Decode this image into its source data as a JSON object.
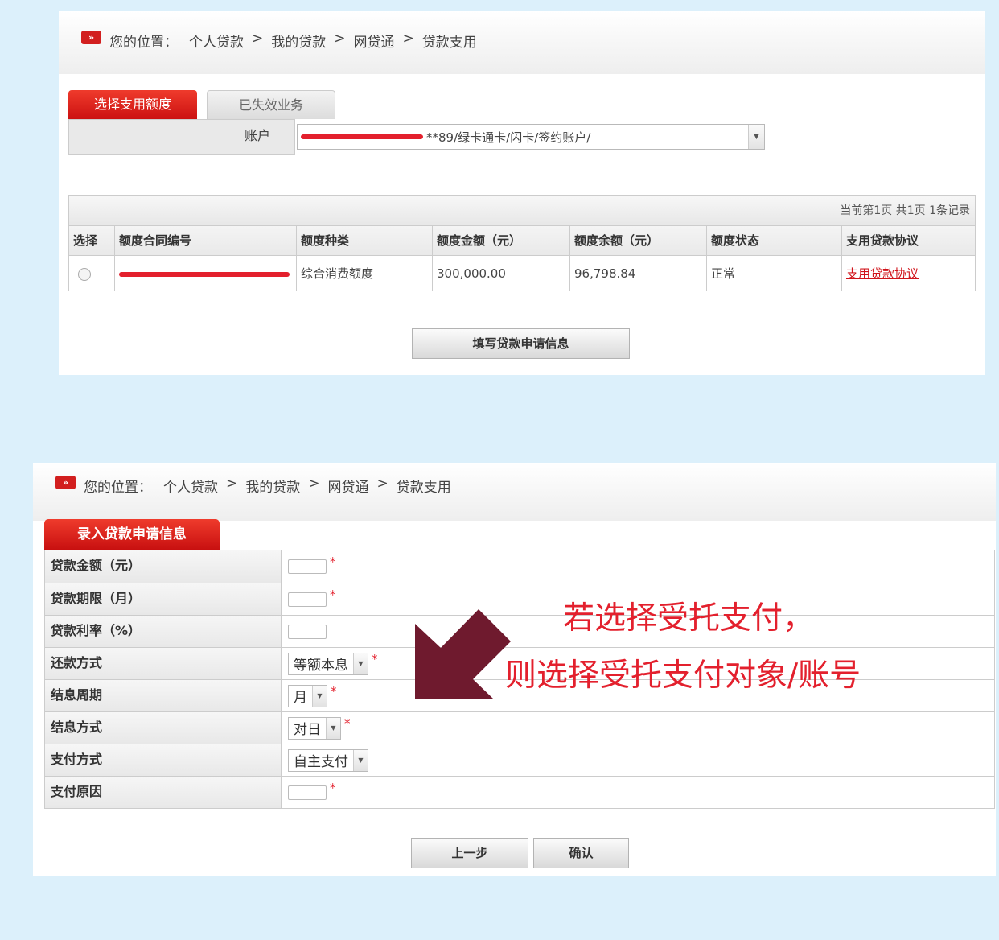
{
  "breadcrumb": {
    "icon": "double-chevron-icon",
    "prefix": "您的位置：",
    "items": [
      "个人贷款",
      "我的贷款",
      "网贷通",
      "贷款支用"
    ],
    "separator": ">"
  },
  "panel1": {
    "tabs": [
      {
        "label": "选择支用额度",
        "active": true
      },
      {
        "label": "已失效业务",
        "active": false
      }
    ],
    "account": {
      "label": "账户",
      "value_suffix": "**89/绿卡通卡/闪卡/签约账户/"
    },
    "pagination": "当前第1页 共1页 1条记录",
    "table": {
      "headers": [
        "选择",
        "额度合同编号",
        "额度种类",
        "额度金额（元）",
        "额度余额（元）",
        "额度状态",
        "支用贷款协议"
      ],
      "rows": [
        {
          "type": "综合消费额度",
          "amount": "300,000.00",
          "balance": "96,798.84",
          "status": "正常",
          "agreement": "支用贷款协议"
        }
      ]
    },
    "fill_button": "填写贷款申请信息"
  },
  "panel2": {
    "tab": "录入贷款申请信息",
    "fields": [
      {
        "label": "贷款金额（元）"
      },
      {
        "label": "贷款期限（月）"
      },
      {
        "label": "贷款利率（%）"
      },
      {
        "label": "还款方式",
        "value": "等额本息"
      },
      {
        "label": "结息周期",
        "value": "月"
      },
      {
        "label": "结息方式",
        "value": "对日"
      },
      {
        "label": "支付方式",
        "value": "自主支付"
      },
      {
        "label": "支付原因"
      }
    ],
    "required_mark": "*",
    "back_button": "上一步",
    "confirm_button": "确认"
  },
  "annotation": {
    "line1": "若选择受托支付，",
    "line2": "则选择受托支付对象/账号",
    "arrow_color": "#6f1a2e",
    "text_color": "#e3202d"
  }
}
